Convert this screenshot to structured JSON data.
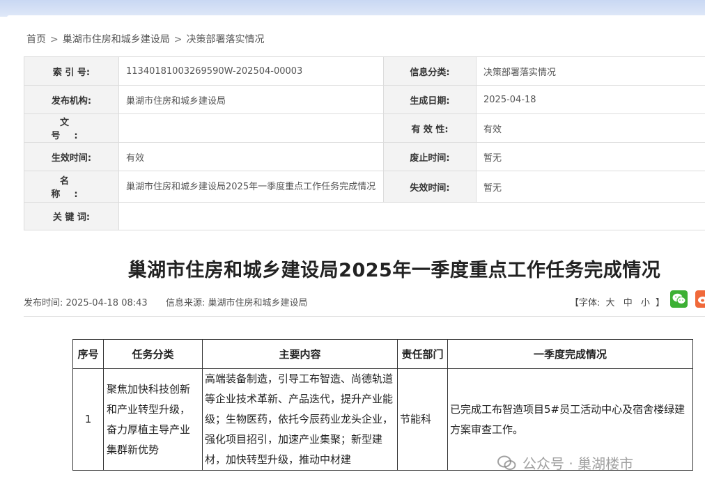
{
  "breadcrumb": {
    "home": "首页",
    "level1": "巢湖市住房和城乡建设局",
    "level2": "决策部署落实情况",
    "separator": ">"
  },
  "meta": {
    "index_label": "索 引 号:",
    "index_value": "11340181003269590W-202504-00003",
    "category_label": "信息分类:",
    "category_value": "决策部署落实情况",
    "publisher_label": "发布机构:",
    "publisher_value": "巢湖市住房和城乡建设局",
    "created_label": "生成日期:",
    "created_value": "2025-04-18",
    "docno_label": "文 号:",
    "docno_value": "",
    "validity_label": "有 效 性:",
    "validity_value": "有效",
    "effective_label": "生效时间:",
    "effective_value": "有效",
    "abolish_label": "废止时间:",
    "abolish_value": "暂无",
    "name_label": "名 称:",
    "name_value": "巢湖市住房和城乡建设局2025年一季度重点工作任务完成情况",
    "expire_label": "失效时间:",
    "expire_value": "暂无",
    "keywords_label": "关 键 词:",
    "keywords_value": ""
  },
  "article": {
    "title": "巢湖市住房和城乡建设局2025年一季度重点工作任务完成情况",
    "publish_time_label": "发布时间:",
    "publish_time": "2025-04-18 08:43",
    "source_label": "信息来源:",
    "source": "巢湖市住房和城乡建设局",
    "fontsize_prefix": "【字体:",
    "fontsize_large": "大",
    "fontsize_medium": "中",
    "fontsize_small": "小",
    "fontsize_suffix": "】"
  },
  "tasks": {
    "headers": [
      "序号",
      "任务分类",
      "主要内容",
      "责任部门",
      "一季度完成情况"
    ],
    "rows": [
      {
        "no": "1",
        "category": "聚焦加快科技创新和产业转型升级，奋力厚植主导产业集群新优势",
        "content": "高端装备制造，引导工布智造、尚德轨道等企业技术革新、产品迭代，提升产业能级；生物医药，依托今辰药业龙头企业，强化项目招引，加速产业集聚；新型建材，加快转型升级，推动中材建",
        "department": "节能科",
        "status": "已完成工布智造项目5#员工活动中心及宿舍楼绿建方案审查工作。"
      }
    ]
  },
  "watermark": {
    "text": "公众号 · 巢湖楼市"
  },
  "icons": {
    "wechat": "wechat-share-icon",
    "weibo": "weibo-share-icon"
  },
  "colors": {
    "wechat": "#3cb034",
    "weibo": "#f0693a",
    "label_bg": "#f3f3f3"
  }
}
